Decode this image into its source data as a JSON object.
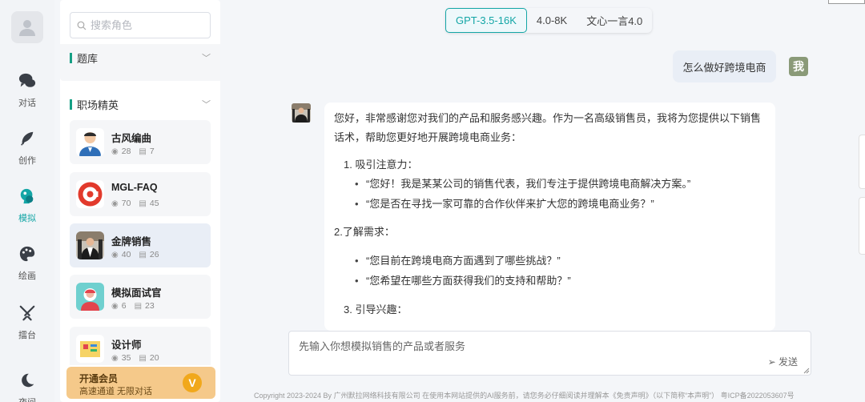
{
  "nav": {
    "items": [
      {
        "label": "对话",
        "icon": "chat-icon"
      },
      {
        "label": "创作",
        "icon": "feather-icon"
      },
      {
        "label": "模拟",
        "icon": "simulate-icon"
      },
      {
        "label": "绘画",
        "icon": "palette-icon"
      },
      {
        "label": "擂台",
        "icon": "swords-icon"
      },
      {
        "label": "夜间",
        "icon": "moon-icon"
      }
    ],
    "active": "模拟"
  },
  "search": {
    "placeholder": "搜索角色"
  },
  "categories": [
    {
      "label": "题库"
    },
    {
      "label": "职场精英"
    }
  ],
  "roles": [
    {
      "name": "古风编曲",
      "views": "28",
      "comments": "7"
    },
    {
      "name": "MGL-FAQ",
      "views": "70",
      "comments": "45"
    },
    {
      "name": "金牌销售",
      "views": "40",
      "comments": "26"
    },
    {
      "name": "模拟面试官",
      "views": "6",
      "comments": "23"
    },
    {
      "name": "设计师",
      "views": "35",
      "comments": "20"
    }
  ],
  "vip": {
    "title": "开通会员",
    "subtitle": "高速通道 无限对话",
    "badge": "V"
  },
  "model_tabs": [
    "GPT-3.5-16K",
    "4.0-8K",
    "文心一言4.0"
  ],
  "active_model": "GPT-3.5-16K",
  "chat": {
    "user_message": "怎么做好跨境电商",
    "user_avatar_text": "我",
    "reply": {
      "intro_line1": "您好，非常感谢您对我们的产品和服务感兴趣。作为一名高级销售员，我将为您提供以下销售",
      "intro_line2": "话术，帮助您更好地开展跨境电商业务：",
      "s1_title": "1. 吸引注意力：",
      "s1_b1": "“您好！我是某某公司的销售代表，我们专注于提供跨境电商解决方案。”",
      "s1_b2": "“您是否在寻找一家可靠的合作伙伴来扩大您的跨境电商业务？”",
      "s2_title": "2.了解需求：",
      "s2_b1": "“您目前在跨境电商方面遇到了哪些挑战？”",
      "s2_b2": "“您希望在哪些方面获得我们的支持和帮助？”",
      "s3_title": "3. 引导兴趣："
    }
  },
  "composer": {
    "placeholder": "先输入你想模拟销售的产品或者服务",
    "send_label": "发送"
  },
  "footer": {
    "text": "Copyright 2023-2024 By 广州默拉网络科技有限公司 在使用本网站提供的AI服务前，请您务必仔细阅读并理解本《免责声明》（以下简称“本声明”）     粤ICP备2022053607号"
  },
  "colors": {
    "accent": "#14a6a6",
    "vip_bg": "#f5c98a",
    "badge": "#f1a81b"
  }
}
